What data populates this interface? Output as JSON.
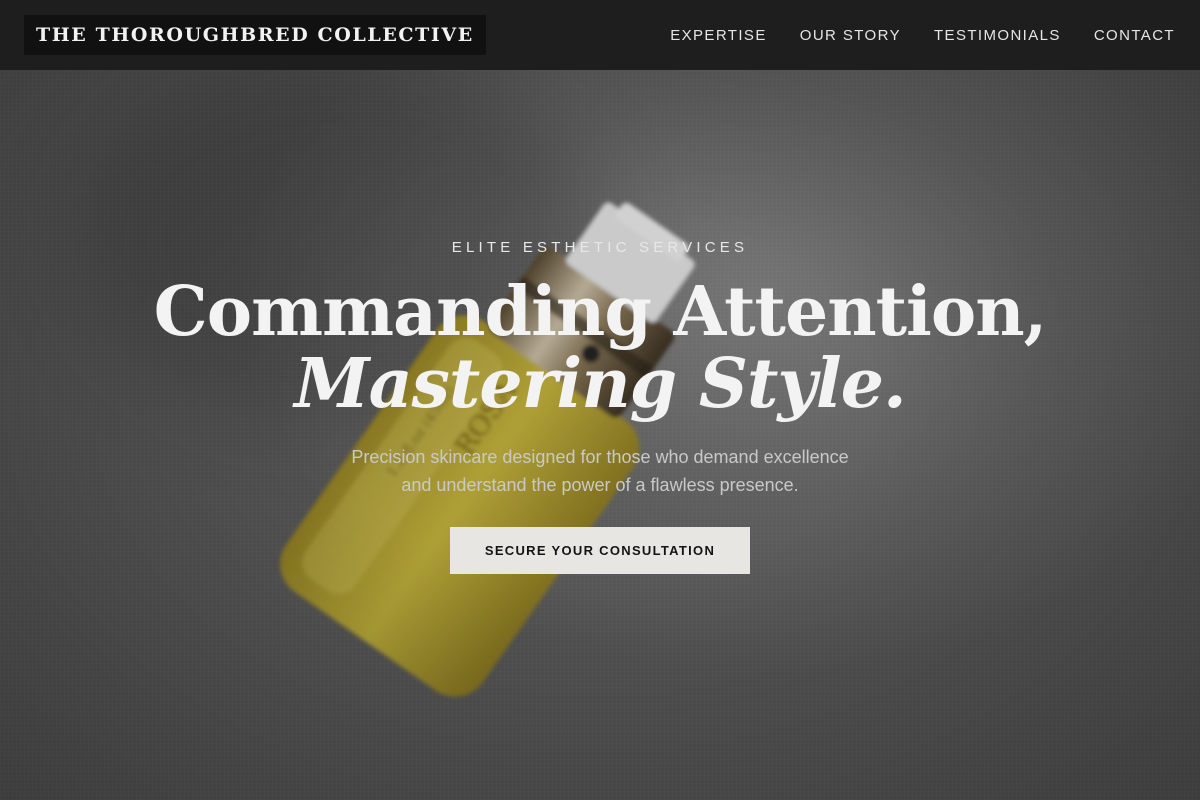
{
  "nav": {
    "brand": "THE THOROUGHBRED COLLECTIVE",
    "links": [
      "EXPERTISE",
      "OUR STORY",
      "TESTIMONIALS",
      "CONTACT"
    ]
  },
  "hero": {
    "eyebrow": "ELITE ESTHETIC SERVICES",
    "headline_line1": "Commanding Attention,",
    "headline_line2": "Mastering Style.",
    "subtext_line1": "Precision skincare designed for those who demand excellence",
    "subtext_line2": "and understand the power of a flawless presence.",
    "cta_label": "SECURE YOUR CONSULTATION",
    "product_label_text": [
      "ROSA",
      "1.2 fl.oz (45ml)"
    ]
  },
  "colors": {
    "nav_bg": "#1e1e1e",
    "brand_bg": "#111111",
    "cta_bg": "#e7e6e3",
    "serum": "#c9b21f"
  }
}
